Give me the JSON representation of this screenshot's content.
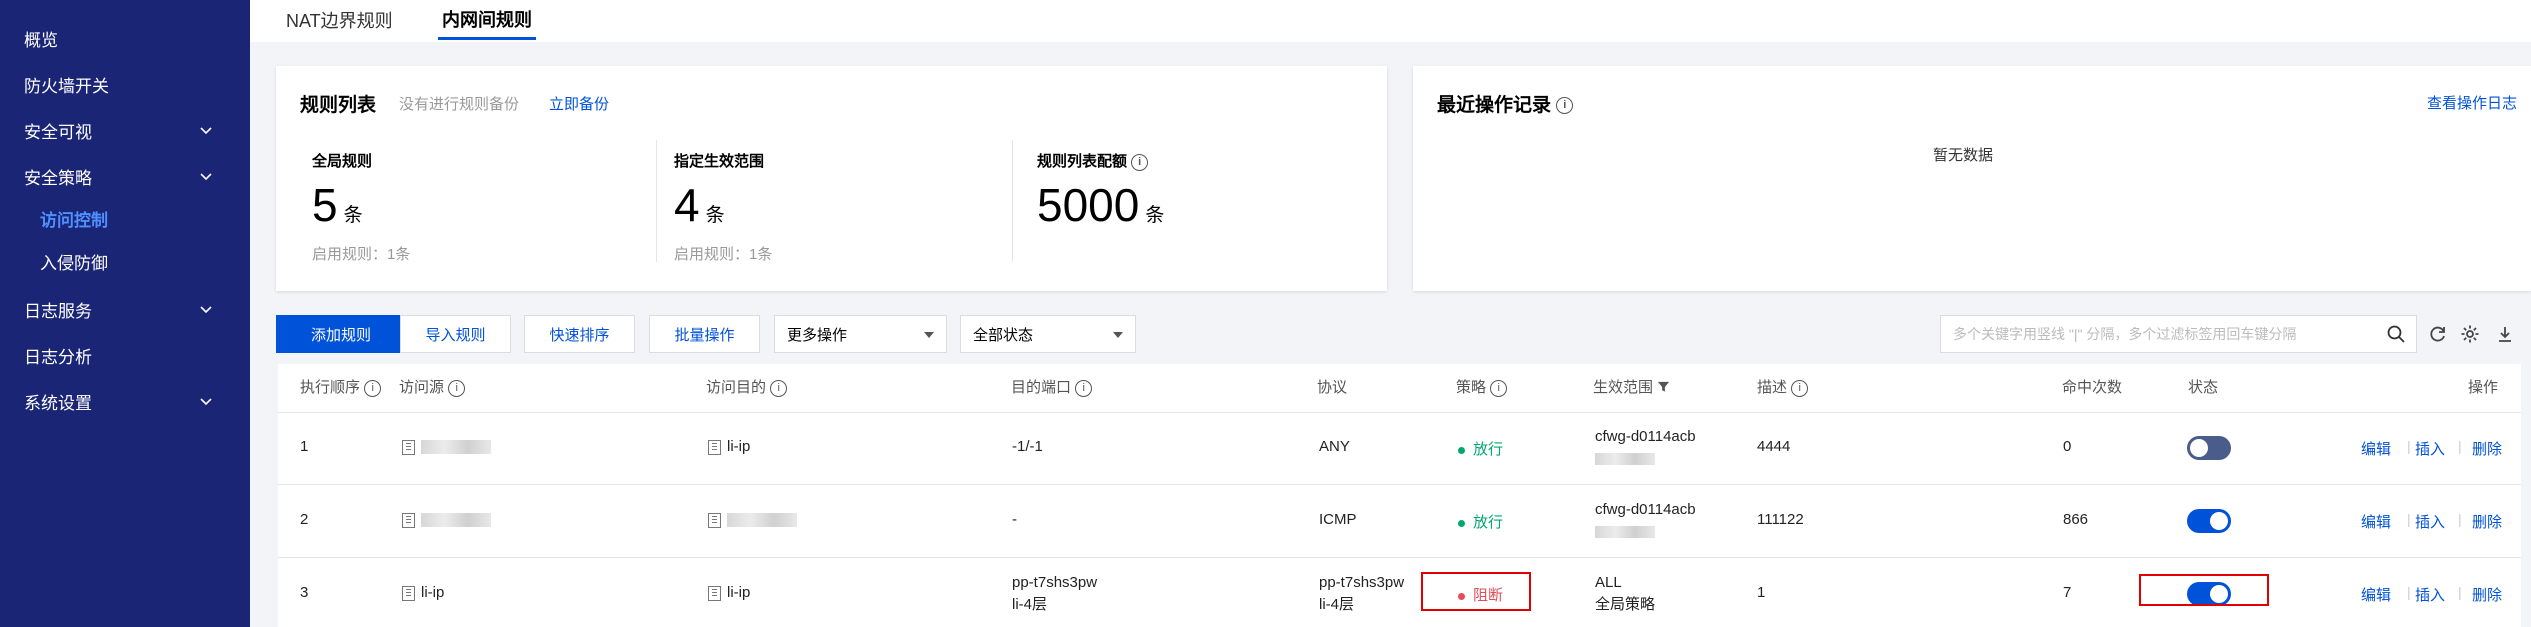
{
  "sidebar": {
    "items": [
      {
        "label": "概览"
      },
      {
        "label": "防火墙开关"
      },
      {
        "label": "安全可视"
      },
      {
        "label": "安全策略"
      },
      {
        "label": "访问控制"
      },
      {
        "label": "入侵防御"
      },
      {
        "label": "日志服务"
      },
      {
        "label": "日志分析"
      },
      {
        "label": "系统设置"
      }
    ]
  },
  "tabs": [
    {
      "label": "NAT边界规则"
    },
    {
      "label": "内网间规则"
    }
  ],
  "rules_card": {
    "title": "规则列表",
    "backup_hint": "没有进行规则备份",
    "backup_link": "立即备份",
    "stats": [
      {
        "label": "全局规则",
        "value": "5",
        "unit": "条",
        "sub": "启用规则：1条"
      },
      {
        "label": "指定生效范围",
        "value": "4",
        "unit": "条",
        "sub": "启用规则：1条"
      },
      {
        "label": "规则列表配额",
        "value": "5000",
        "unit": "条",
        "sub": ""
      }
    ]
  },
  "recent_card": {
    "title": "最近操作记录",
    "link": "查看操作日志",
    "empty": "暂无数据"
  },
  "toolbar": {
    "add": "添加规则",
    "import": "导入规则",
    "sort": "快速排序",
    "batch": "批量操作",
    "more": "更多操作",
    "status": "全部状态",
    "search_placeholder": "多个关键字用竖线 \"|\" 分隔，多个过滤标签用回车键分隔"
  },
  "table": {
    "headers": {
      "order": "执行顺序",
      "source": "访问源",
      "dest": "访问目的",
      "port": "目的端口",
      "protocol": "协议",
      "policy": "策略",
      "scope": "生效范围",
      "desc": "描述",
      "hits": "命中次数",
      "status": "状态",
      "ops": "操作"
    },
    "ops": {
      "edit": "编辑",
      "insert": "插入",
      "delete": "删除"
    },
    "rows": [
      {
        "order": "1",
        "source": "",
        "dest": "li-ip",
        "port": "-1/-1",
        "port2": "",
        "protocol": "ANY",
        "protocol2": "",
        "policy": "放行",
        "scope": "cfwg-d0114acb",
        "scope2": "",
        "desc": "4444",
        "hits": "0",
        "enabled": false
      },
      {
        "order": "2",
        "source": "",
        "dest": "",
        "port": "-",
        "port2": "",
        "protocol": "ICMP",
        "protocol2": "",
        "policy": "放行",
        "scope": "cfwg-d0114acb",
        "scope2": "",
        "desc": "111122",
        "hits": "866",
        "enabled": true
      },
      {
        "order": "3",
        "source": "li-ip",
        "dest": "li-ip",
        "port": "pp-t7shs3pw",
        "port2": "li-4层",
        "protocol": "pp-t7shs3pw",
        "protocol2": "li-4层",
        "policy": "阻断",
        "scope": "ALL",
        "scope2": "全局策略",
        "desc": "1",
        "hits": "7",
        "enabled": true
      }
    ]
  },
  "colors": {
    "sidebar_bg": "#1b2576",
    "primary": "#0052d9",
    "allow": "#00a870",
    "block": "#e34d59",
    "toggle_off": "#4a5d8a",
    "highlight_box": "#e00000"
  }
}
